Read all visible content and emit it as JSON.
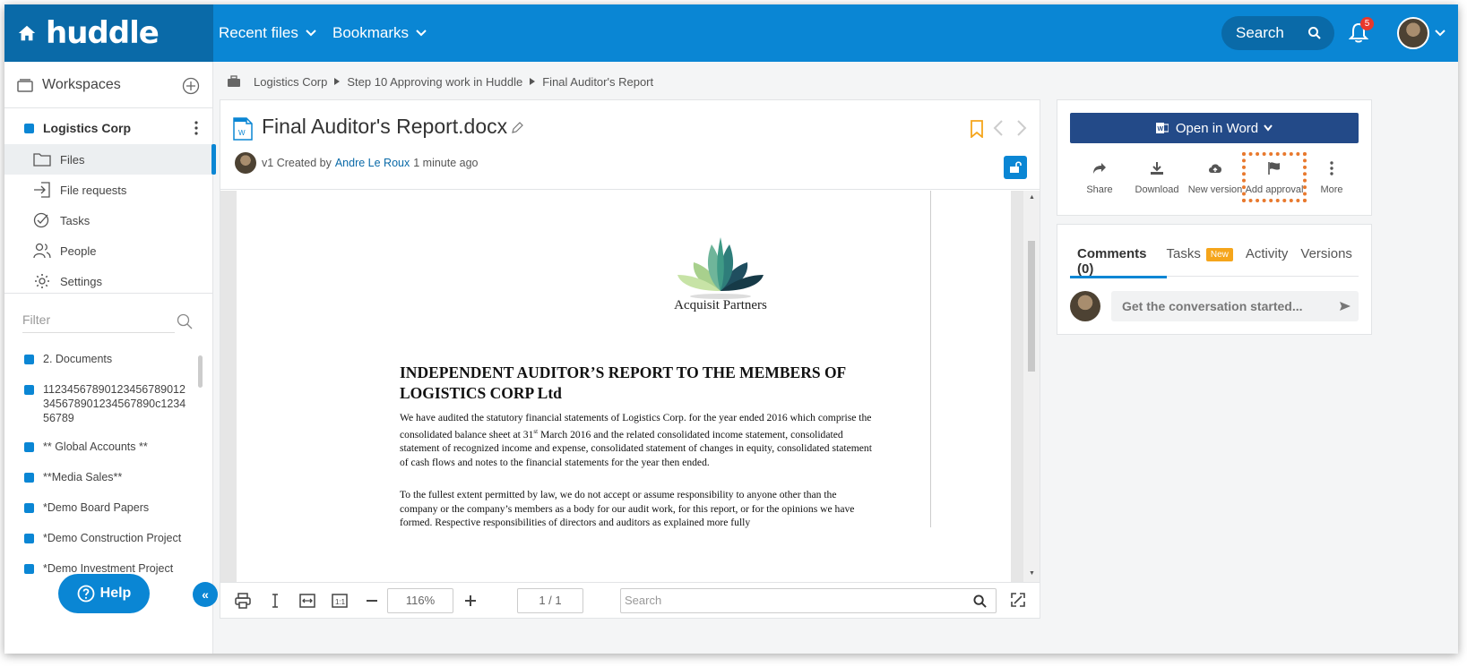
{
  "brand": {
    "logo": "huddle"
  },
  "topnav": {
    "recent_files": "Recent files",
    "bookmarks": "Bookmarks",
    "search": "Search",
    "notifications_count": "5"
  },
  "sidebar": {
    "workspaces_label": "Workspaces",
    "org_name": "Logistics Corp",
    "nav": [
      {
        "label": "Files",
        "icon": "folder-icon",
        "active": true
      },
      {
        "label": "File requests",
        "icon": "file-request-icon"
      },
      {
        "label": "Tasks",
        "icon": "tasks-icon"
      },
      {
        "label": "People",
        "icon": "people-icon"
      },
      {
        "label": "Settings",
        "icon": "gear-icon"
      }
    ],
    "filter_placeholder": "Filter",
    "workspaces": [
      "2. Documents",
      "11234567890123456789012345678901234567890c123456789",
      "** Global Accounts **",
      "**Media Sales**",
      "*Demo Board Papers",
      "*Demo Construction Project",
      "*Demo Investment Project"
    ],
    "help_label": "Help",
    "collapse_label": "«"
  },
  "breadcrumb": [
    "Logistics Corp",
    "Step 10 Approving work in Huddle",
    "Final Auditor's Report"
  ],
  "document": {
    "title": "Final Auditor's Report.docx",
    "version": "v1",
    "created_by_prefix": "Created by",
    "author": "Andre Le Roux",
    "time": "1 minute ago",
    "company": "Acquisit Partners",
    "heading": "INDEPENDENT AUDITOR’S REPORT TO THE MEMBERS OF LOGISTICS CORP Ltd",
    "para1_a": "We have audited the statutory financial statements of Logistics Corp. for the year ended 2016 which comprise the consolidated balance sheet at 31",
    "para1_sup": "st",
    "para1_b": " March 2016 and the related consolidated income statement, consolidated statement of recognized income and expense, consolidated statement of changes in equity, consolidated statement of cash flows and notes to the financial statements for the year then ended.",
    "para2": "To the fullest extent permitted by law, we do not accept or assume responsibility to anyone other than the company or the company’s members as a body for our audit work, for this report, or for the opinions we have formed. Respective responsibilities of directors and auditors as explained more fully"
  },
  "viewer": {
    "zoom": "116%",
    "page": "1 / 1",
    "search_placeholder": "Search"
  },
  "actions": {
    "open_in_word": "Open in Word",
    "share": "Share",
    "download": "Download",
    "new_version": "New version",
    "add_approval": "Add approval",
    "more": "More"
  },
  "tabs": {
    "comments": "Comments (0)",
    "tasks": "Tasks",
    "tasks_badge": "New",
    "activity": "Activity",
    "versions": "Versions"
  },
  "comment_placeholder": "Get the conversation started...",
  "colors": {
    "primary": "#0a86d4",
    "brand_dark": "#0a6aa8",
    "word_button": "#234a88",
    "highlight": "#e8792e",
    "badge_new": "#f5a51b"
  }
}
